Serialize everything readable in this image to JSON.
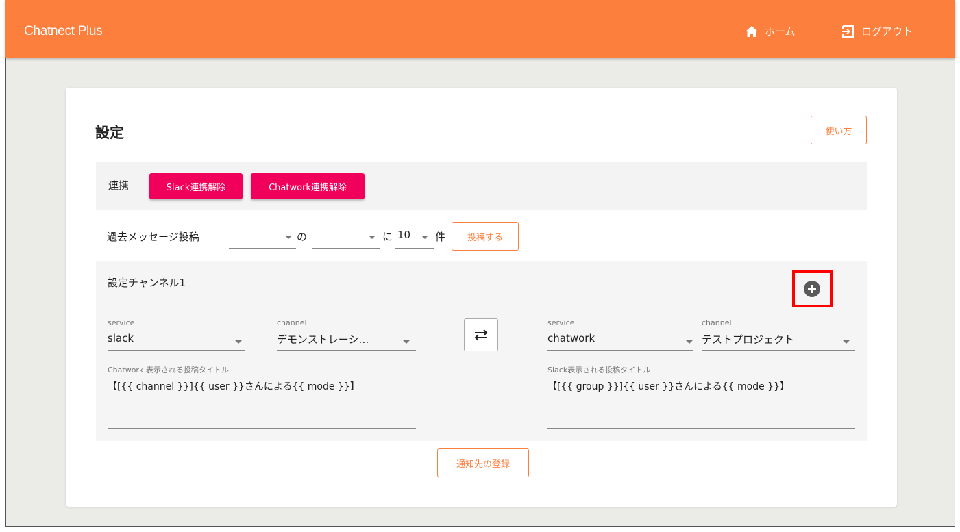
{
  "app": {
    "title": "Chatnect Plus"
  },
  "nav": {
    "home_label": "ホーム",
    "logout_label": "ログアウト"
  },
  "page": {
    "title": "設定",
    "howto_label": "使い方"
  },
  "integration": {
    "label": "連携",
    "slack_unlink_label": "Slack連携解除",
    "chatwork_unlink_label": "Chatwork連携解除"
  },
  "past_messages": {
    "label": "過去メッセージ投稿",
    "select1_value": "",
    "of_text": "の",
    "select2_value": "",
    "ni_text": "に",
    "count_value": "10",
    "unit_text": "件",
    "post_label": "投稿する"
  },
  "channel_setting": {
    "title": "設定チャンネル1",
    "left": {
      "service_label": "service",
      "service_value": "slack",
      "channel_label": "channel",
      "channel_value": "デモンストレーシ…",
      "post_title_label": "Chatwork 表示される投稿タイトル",
      "post_title_value": "【[{{ channel }}]{{ user }}さんによる{{ mode }}】"
    },
    "right": {
      "service_label": "service",
      "service_value": "chatwork",
      "channel_label": "channel",
      "channel_value": "テストプロジェクト",
      "post_title_label": "Slack表示される投稿タイトル",
      "post_title_value": "【[{{ group }}]{{ user }}さんによる{{ mode }}】"
    }
  },
  "register_label": "通知先の登録",
  "colors": {
    "appbar": "#fd7f3e",
    "accent": "#fd7f3e",
    "danger": "#f0005a",
    "highlight": "#ff0000"
  }
}
